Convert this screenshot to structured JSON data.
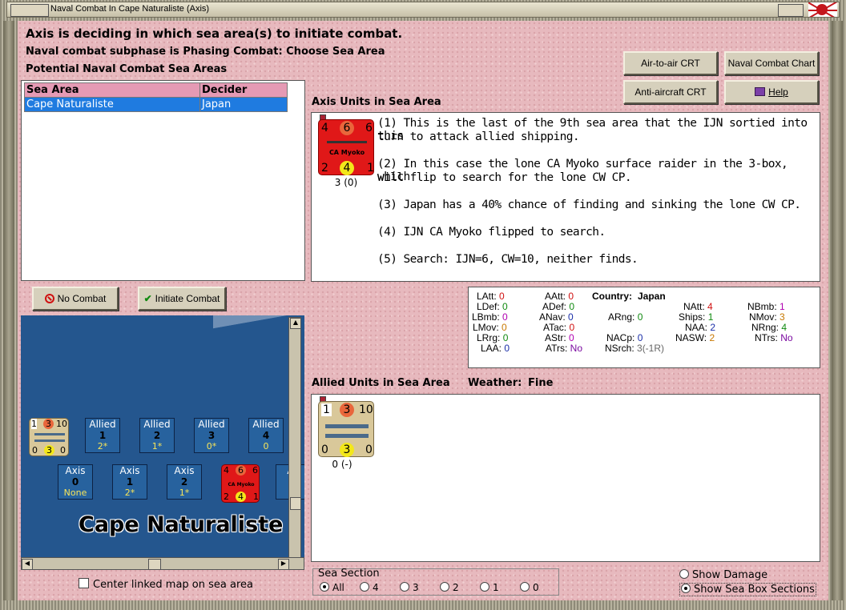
{
  "window": {
    "title": "Naval Combat In Cape Naturaliste (Axis)"
  },
  "header": {
    "line1": "Axis is deciding in which sea area(s) to initiate combat.",
    "line2": "Naval combat subphase is Phasing Combat: Choose Sea Area",
    "line3": "Potential Naval Combat Sea Areas"
  },
  "buttons": {
    "air_to_air": "Air-to-air CRT",
    "naval_chart": "Naval Combat Chart",
    "anti_aircraft": "Anti-aircraft CRT",
    "help": "Help",
    "no_combat": "No Combat",
    "initiate": "Initiate Combat"
  },
  "sea_table": {
    "col_area": "Sea Area",
    "col_decider": "Decider",
    "rows": [
      {
        "area": "Cape Naturaliste",
        "decider": "Japan"
      }
    ]
  },
  "axis_units": {
    "label": "Axis Units in Sea Area",
    "counter": {
      "top_left": "4",
      "top_mid": "6",
      "top_right": "6",
      "name": "CA Myoko",
      "bot_left": "2",
      "bot_mid": "4",
      "bot_right": "1",
      "caption": "3 (0)"
    },
    "notes": [
      "(1) This is the last of the 9th  sea area that the IJN sortied into this",
      "turn to attack allied shipping.",
      "(2)  In this case the lone CA Myoko surface raider in the 3-box, which",
      "will flip to search for the lone CW CP.",
      "(3) Japan has a 40% chance of finding and sinking the lone CW CP.",
      "(4) IJN CA Myoko flipped to search.",
      "(5) Search:  IJN=6, CW=10, neither finds."
    ]
  },
  "stats": {
    "LAtt": "0",
    "LDef": "0",
    "LBmb": "0",
    "LMov": "0",
    "LRrg": "0",
    "LAA": "0",
    "AAtt": "0",
    "ADef": "0",
    "ANav": "0",
    "ATac": "0",
    "AStr": "0",
    "ATrs": "No",
    "country_label": "Country:",
    "country": "Japan",
    "ARng": "0",
    "NACp": "0",
    "NSrch": "3(-1R)",
    "NAtt": "4",
    "Ships": "1",
    "NAA": "2",
    "NASW": "2",
    "NBmb": "1",
    "NMov": "3",
    "NRng": "4",
    "NTrs": "No",
    "colors": {
      "red": "#d01010",
      "green": "#108a10",
      "blue": "#1a2ea8",
      "magenta": "#b000b0",
      "orange": "#c87800",
      "purple": "#7a0aa0",
      "gray": "#666666"
    }
  },
  "allied_units": {
    "label": "Allied Units in Sea Area",
    "weather_label": "Weather:",
    "weather": "Fine",
    "counter": {
      "top_left": "1",
      "top_mid": "3",
      "top_right": "10",
      "bot_left": "0",
      "bot_mid": "3",
      "bot_right": "0",
      "caption": "0 (-)"
    }
  },
  "map": {
    "name": "Cape Naturaliste",
    "allied_boxes": [
      {
        "title": "Allied",
        "num": "1",
        "val": "2*"
      },
      {
        "title": "Allied",
        "num": "2",
        "val": "1*"
      },
      {
        "title": "Allied",
        "num": "3",
        "val": "0*"
      },
      {
        "title": "Allied",
        "num": "4",
        "val": "0"
      }
    ],
    "axis_boxes": [
      {
        "title": "Axis",
        "num": "0",
        "val": "None"
      },
      {
        "title": "Axis",
        "num": "1",
        "val": "2*"
      },
      {
        "title": "Axis",
        "num": "2",
        "val": "1*"
      },
      {
        "title": "Ax",
        "num": "",
        "val": ""
      }
    ],
    "small_allied": {
      "a": "1",
      "b": "3",
      "c": "10",
      "d": "0",
      "e": "3",
      "f": "0"
    },
    "small_axis": {
      "a": "4",
      "b": "6",
      "c": "6",
      "name": "CA Myoko",
      "d": "2",
      "e": "4",
      "f": "1"
    },
    "center_checkbox": "Center linked map on sea area"
  },
  "sea_section": {
    "label": "Sea Section",
    "options": [
      "All",
      "4",
      "3",
      "2",
      "1",
      "0"
    ],
    "selected": "All"
  },
  "view_options": {
    "show_damage": "Show Damage",
    "show_sections": "Show Sea Box Sections"
  }
}
